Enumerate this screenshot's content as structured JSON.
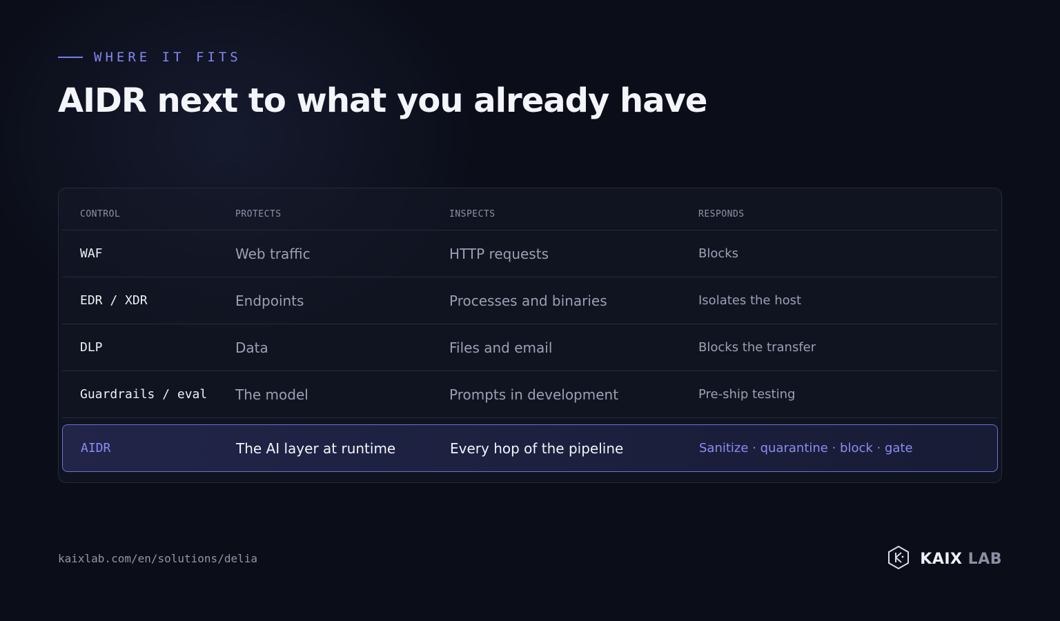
{
  "header": {
    "eyebrow": "WHERE IT FITS",
    "title": "AIDR next to what you already have"
  },
  "table": {
    "columns": [
      "CONTROL",
      "PROTECTS",
      "INSPECTS",
      "RESPONDS"
    ],
    "rows": [
      {
        "control": "WAF",
        "protects": "Web traffic",
        "inspects": "HTTP requests",
        "responds": "Blocks"
      },
      {
        "control": "EDR / XDR",
        "protects": "Endpoints",
        "inspects": "Processes and binaries",
        "responds": "Isolates the host"
      },
      {
        "control": "DLP",
        "protects": "Data",
        "inspects": "Files and email",
        "responds": "Blocks the transfer"
      },
      {
        "control": "Guardrails / eval",
        "protects": "The model",
        "inspects": "Prompts in development",
        "responds": "Pre-ship testing"
      }
    ],
    "highlight": {
      "control": "AIDR",
      "protects": "The AI layer at runtime",
      "inspects": "Every hop of the pipeline",
      "responds": "Sanitize · quarantine · block · gate"
    }
  },
  "footer": {
    "url": "kaixlab.com/en/solutions/delia",
    "brand_primary": "KAIX",
    "brand_secondary": "LAB",
    "logo_icon": "hexagon-k-icon"
  },
  "colors": {
    "background": "#0b0e19",
    "accent": "#8587f3"
  }
}
